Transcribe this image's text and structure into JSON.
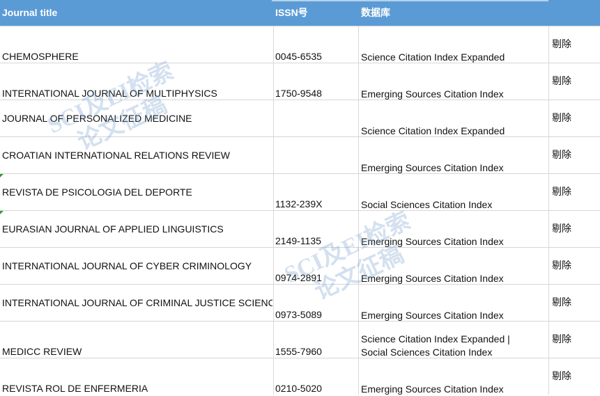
{
  "header": {
    "title": "Journal title",
    "issn": "ISSN号",
    "database": "数据库"
  },
  "rows": [
    {
      "title": "CHEMOSPHERE",
      "issn": "0045-6535",
      "db": [
        "Science Citation Index Expanded"
      ],
      "action": "剔除"
    },
    {
      "title": "INTERNATIONAL JOURNAL OF MULTIPHYSICS",
      "issn": "1750-9548",
      "db": [
        "Emerging Sources Citation Index"
      ],
      "action": "剔除"
    },
    {
      "title": "JOURNAL OF PERSONALIZED MEDICINE",
      "issn": "",
      "db": [
        "Science Citation Index Expanded"
      ],
      "action": "剔除"
    },
    {
      "title": "CROATIAN INTERNATIONAL RELATIONS REVIEW",
      "issn": "",
      "db": [
        "Emerging Sources Citation Index"
      ],
      "action": "剔除"
    },
    {
      "title": "REVISTA DE PSICOLOGIA DEL DEPORTE",
      "issn": "1132-239X",
      "db": [
        "Social Sciences Citation Index"
      ],
      "action": "剔除"
    },
    {
      "title": "EURASIAN JOURNAL OF APPLIED LINGUISTICS",
      "issn": "2149-1135",
      "db": [
        "Emerging Sources Citation Index"
      ],
      "action": "剔除"
    },
    {
      "title": "INTERNATIONAL JOURNAL OF CYBER CRIMINOLOGY",
      "issn": "0974-2891",
      "db": [
        "Emerging Sources Citation Index"
      ],
      "action": "剔除"
    },
    {
      "title": "INTERNATIONAL JOURNAL OF CRIMINAL JUSTICE SCIENCES",
      "issn": "0973-5089",
      "db": [
        "Emerging Sources Citation Index"
      ],
      "action": "剔除"
    },
    {
      "title": "MEDICC REVIEW",
      "issn": "1555-7960",
      "db": [
        "Science Citation Index Expanded |",
        "Social Sciences Citation Index"
      ],
      "action": "剔除"
    },
    {
      "title": "REVISTA ROL DE ENFERMERIA",
      "issn": "0210-5020",
      "db": [
        "Emerging Sources Citation Index"
      ],
      "action": "剔除"
    }
  ],
  "watermarks": [
    {
      "line1": "SCI及EI检索",
      "line2": "论文征稿"
    },
    {
      "line1": "SCI及EI检索",
      "line2": "论文征稿"
    }
  ]
}
